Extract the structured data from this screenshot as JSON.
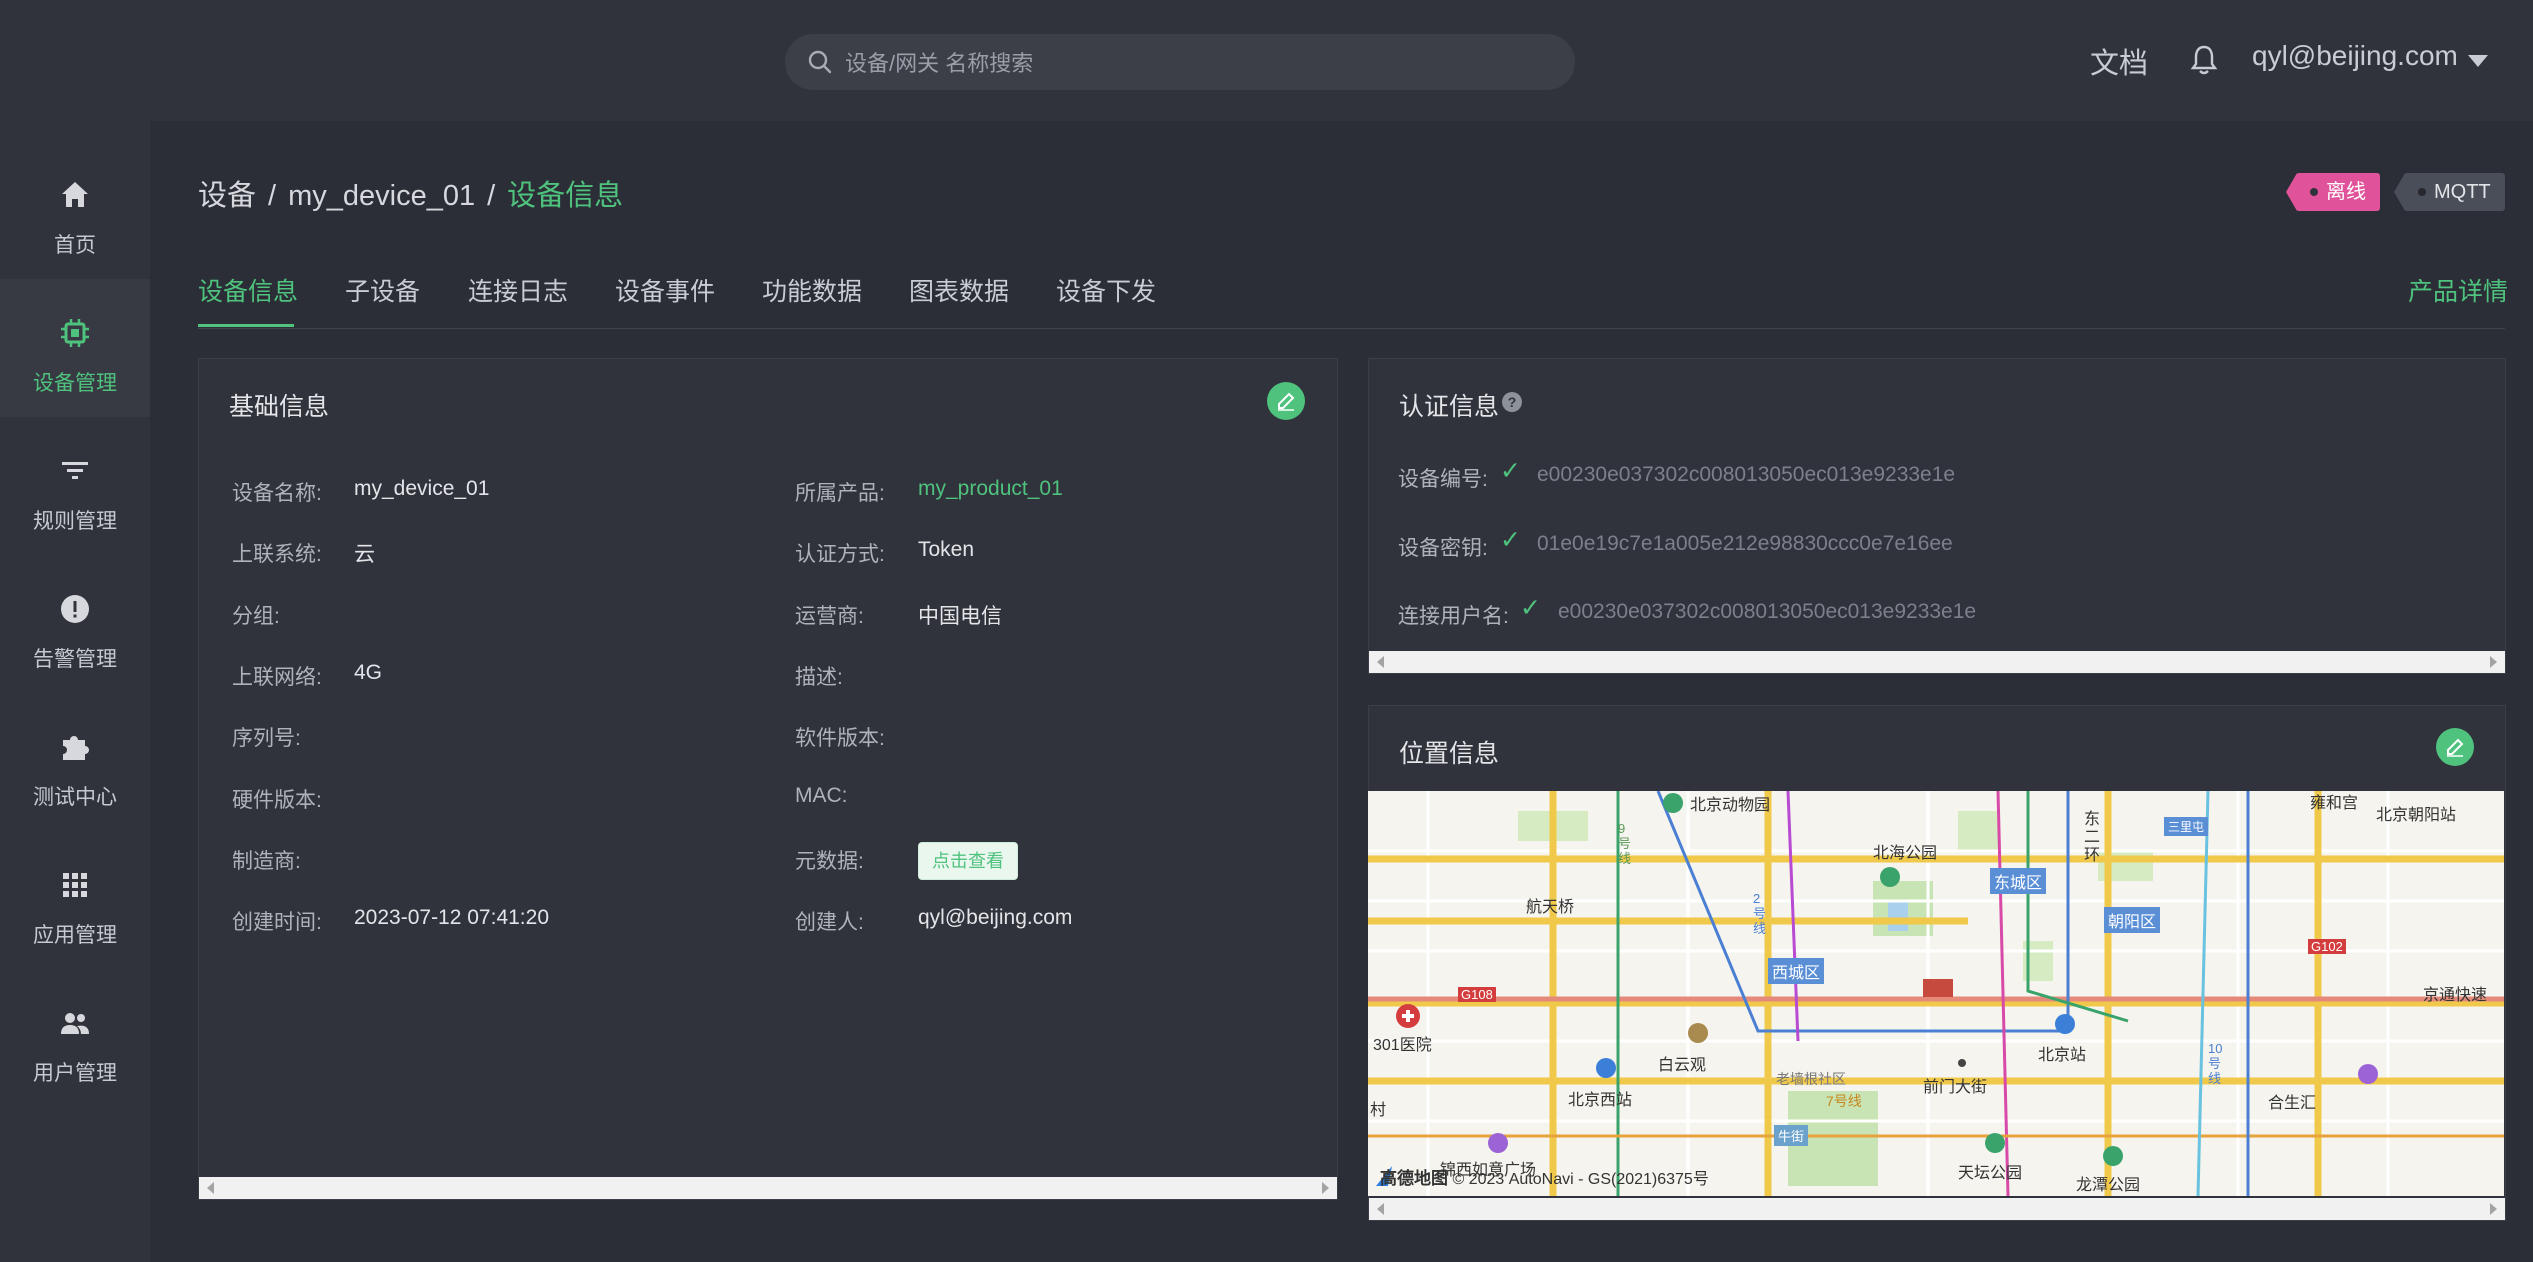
{
  "header": {
    "search_placeholder": "设备/网关 名称搜索",
    "docs_label": "文档",
    "user_email": "qyl@beijing.com"
  },
  "sidebar": {
    "items": [
      {
        "label": "首页",
        "icon": "home-icon"
      },
      {
        "label": "设备管理",
        "icon": "chip-icon",
        "active": true
      },
      {
        "label": "规则管理",
        "icon": "filter-icon"
      },
      {
        "label": "告警管理",
        "icon": "alert-icon"
      },
      {
        "label": "测试中心",
        "icon": "puzzle-icon"
      },
      {
        "label": "应用管理",
        "icon": "apps-grid-icon"
      },
      {
        "label": "用户管理",
        "icon": "users-icon"
      }
    ]
  },
  "breadcrumb": {
    "root": "设备",
    "device": "my_device_01",
    "current": "设备信息"
  },
  "status": {
    "online_tag": "离线",
    "protocol_tag": "MQTT"
  },
  "tabs": [
    "设备信息",
    "子设备",
    "连接日志",
    "设备事件",
    "功能数据",
    "图表数据",
    "设备下发"
  ],
  "product_detail_link": "产品详情",
  "basic_info": {
    "title": "基础信息",
    "left": [
      {
        "label": "设备名称:",
        "value": "my_device_01"
      },
      {
        "label": "上联系统:",
        "value": "云"
      },
      {
        "label": "分组:",
        "value": ""
      },
      {
        "label": "上联网络:",
        "value": "4G"
      },
      {
        "label": "序列号:",
        "value": ""
      },
      {
        "label": "硬件版本:",
        "value": ""
      },
      {
        "label": "制造商:",
        "value": ""
      },
      {
        "label": "创建时间:",
        "value": "2023-07-12 07:41:20"
      }
    ],
    "right": [
      {
        "label": "所属产品:",
        "value": "my_product_01"
      },
      {
        "label": "认证方式:",
        "value": "Token"
      },
      {
        "label": "运营商:",
        "value": "中国电信"
      },
      {
        "label": "描述:",
        "value": ""
      },
      {
        "label": "软件版本:",
        "value": ""
      },
      {
        "label": "MAC:",
        "value": ""
      },
      {
        "label": "元数据:",
        "value": "点击查看"
      },
      {
        "label": "创建人:",
        "value": "qyl@beijing.com"
      }
    ]
  },
  "auth_info": {
    "title": "认证信息",
    "rows": [
      {
        "label": "设备编号:",
        "value": "e00230e037302c008013050ec013e9233e1e"
      },
      {
        "label": "设备密钥:",
        "value": "01e0e19c7e1a005e212e98830ccc0e7e16ee"
      },
      {
        "label": "连接用户名:",
        "value": "e00230e037302c008013050ec013e9233e1e"
      }
    ]
  },
  "location_info": {
    "title": "位置信息",
    "map_labels": {
      "zoo": "北京动物园",
      "yonghegong": "雍和宫",
      "chaoyang_station": "北京朝阳站",
      "beihai": "北海公园",
      "dongcheng": "东城区",
      "chaoyang": "朝阳区",
      "xicheng": "西城区",
      "hangtianqiao": "航天桥",
      "hospital301": "301医院",
      "baiyunguan": "白云观",
      "beijing_west": "北京西站",
      "beijing_station": "北京站",
      "laoqianggen": "老墙根社区",
      "qianmen": "前门大街",
      "hesheng": "合生汇",
      "tiantan": "天坛公园",
      "longtan": "龙潭公园",
      "niujie": "牛街",
      "jingtong": "京通快速",
      "donghuan": "东二环",
      "line9": "9号线",
      "line2": "2号线",
      "line10": "10号线",
      "line7": "7号线",
      "sanlitun": "三里屯",
      "edge": "村",
      "plaza": "锦西如意广场",
      "g108": "G108",
      "g102": "G102"
    },
    "map_brand": "高德地图",
    "map_copyright": "© 2023 AutoNavi - GS(2021)6375号"
  },
  "colors": {
    "accent": "#4fc27e",
    "offline_tag": "#e0529a",
    "bg": "#2b2e36",
    "panel": "#30333b"
  }
}
